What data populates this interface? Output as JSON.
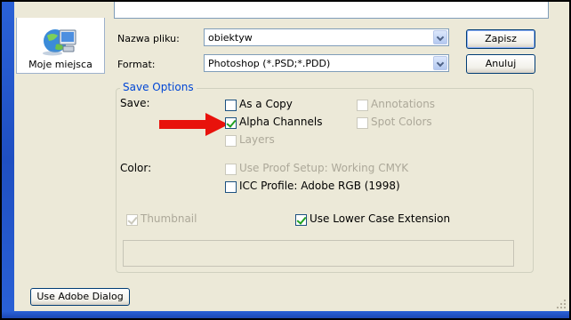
{
  "places": {
    "label": "Moje miejsca",
    "icon": "computer-network-icon"
  },
  "file": {
    "name_label": "Nazwa pliku:",
    "name_value": "obiektyw",
    "format_label": "Format:",
    "format_value": "Photoshop (*.PSD;*.PDD)"
  },
  "buttons": {
    "save": "Zapisz",
    "cancel": "Anuluj",
    "adobe_dialog": "Use Adobe Dialog"
  },
  "save_options": {
    "title": "Save Options",
    "save_label": "Save:",
    "as_a_copy": {
      "label": "As a Copy",
      "checked": false,
      "enabled": true
    },
    "annotations": {
      "label": "Annotations",
      "checked": false,
      "enabled": false
    },
    "alpha_channels": {
      "label": "Alpha Channels",
      "checked": true,
      "enabled": true
    },
    "spot_colors": {
      "label": "Spot Colors",
      "checked": false,
      "enabled": false
    },
    "layers": {
      "label": "Layers",
      "checked": false,
      "enabled": false
    },
    "color_label": "Color:",
    "use_proof_setup": {
      "label": "Use Proof Setup:  Working CMYK",
      "checked": false,
      "enabled": false
    },
    "icc_profile": {
      "label": "ICC Profile:  Adobe RGB (1998)",
      "checked": false,
      "enabled": true
    },
    "thumbnail": {
      "label": "Thumbnail",
      "checked": true,
      "enabled": false
    },
    "lower_case_ext": {
      "label": "Use Lower Case Extension",
      "checked": true,
      "enabled": true
    }
  },
  "colors": {
    "accent": "#0046d5",
    "arrow": "#e8120c",
    "window_blue": "#2a61d6"
  }
}
